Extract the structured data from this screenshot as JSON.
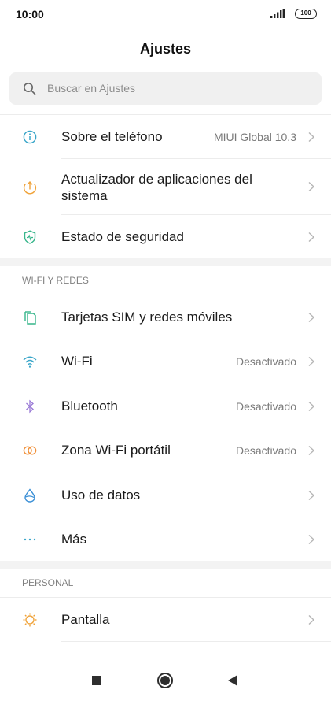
{
  "status": {
    "time": "10:00",
    "battery": "100"
  },
  "header": {
    "title": "Ajustes"
  },
  "search": {
    "placeholder": "Buscar en Ajustes"
  },
  "groups": {
    "top": [
      {
        "label": "Sobre el teléfono",
        "value": "MIUI Global 10.3",
        "icon": "info-icon"
      },
      {
        "label": "Actualizador de aplicaciones del sistema",
        "value": "",
        "icon": "update-arrow-icon"
      },
      {
        "label": "Estado de seguridad",
        "value": "",
        "icon": "shield-icon"
      }
    ],
    "wifi": {
      "header": "WI-FI Y REDES",
      "items": [
        {
          "label": "Tarjetas SIM y redes móviles",
          "value": "",
          "icon": "sim-card-icon"
        },
        {
          "label": "Wi-Fi",
          "value": "Desactivado",
          "icon": "wifi-icon"
        },
        {
          "label": "Bluetooth",
          "value": "Desactivado",
          "icon": "bluetooth-icon"
        },
        {
          "label": "Zona Wi-Fi portátil",
          "value": "Desactivado",
          "icon": "hotspot-icon"
        },
        {
          "label": "Uso de datos",
          "value": "",
          "icon": "data-drop-icon"
        },
        {
          "label": "Más",
          "value": "",
          "icon": "more-dots-icon"
        }
      ]
    },
    "personal": {
      "header": "PERSONAL",
      "items": [
        {
          "label": "Pantalla",
          "value": "",
          "icon": "brightness-icon"
        }
      ]
    }
  },
  "colors": {
    "info": "#3aa6c9",
    "update": "#f0a33a",
    "security": "#36b58a",
    "sim": "#36b58a",
    "wifi": "#3aa6c9",
    "bluetooth": "#9a7ad6",
    "hotspot": "#f0903a",
    "data": "#3a8fd6",
    "more": "#3aa6c9",
    "display": "#f0a33a"
  }
}
